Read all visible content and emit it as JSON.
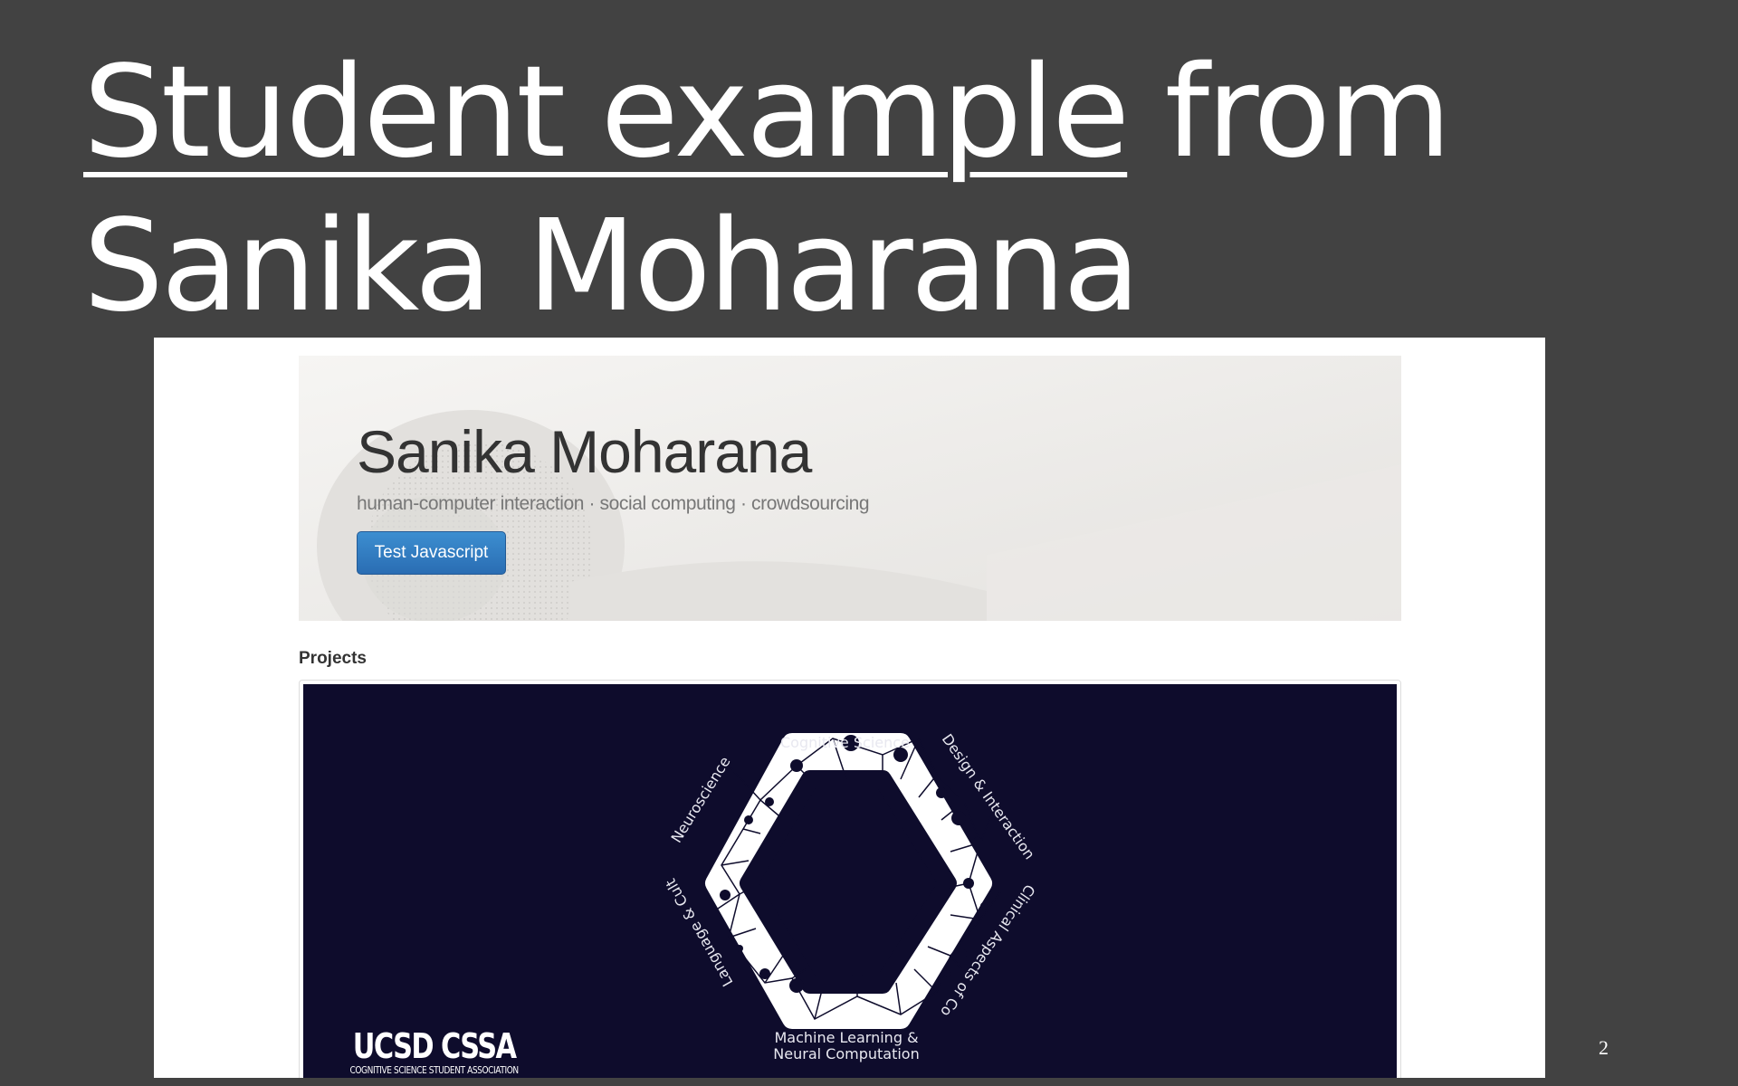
{
  "slide": {
    "title_underlined": "Student example",
    "title_rest": " from Sanika Moharana",
    "page_number": "2"
  },
  "website": {
    "name": "Sanika Moharana",
    "tagline": "human-computer interaction · social computing · crowdsourcing",
    "button_label": "Test Javascript",
    "section_heading": "Projects",
    "project_image": {
      "logo_text": "UCSD CSSA",
      "logo_subtext": "COGNITIVE SCIENCE STUDENT ASSOCIATION",
      "labels": {
        "top": "Cognitive Science",
        "top_right": "Design & Interaction (HCI)",
        "right": "Clinical Aspects of Cognition",
        "bottom_line1": "Machine Learning &",
        "bottom_line2": "Neural Computation",
        "left": "Language & Culture",
        "top_left": "Neuroscience"
      }
    }
  },
  "colors": {
    "slide_background": "#424242",
    "jumbotron_background": "#f0efed",
    "button_blue": "#337ab7",
    "project_image_background": "#0e0c2c"
  }
}
